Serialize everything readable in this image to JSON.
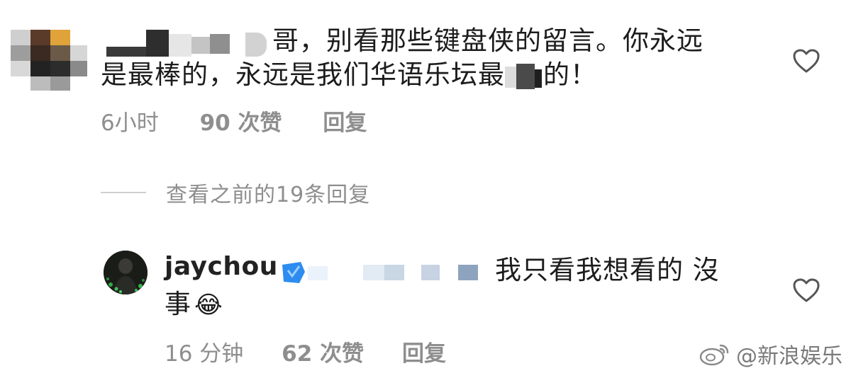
{
  "comment1": {
    "line1_text": "哥，别看那些键盘侠的留言。你永远",
    "line2_part1": "是最棒的，永远是我们华语乐坛最",
    "line2_part2": "的！",
    "time": "6小时",
    "likes": "90 次赞",
    "reply_label": "回复"
  },
  "view_more": {
    "label": "查看之前的19条回复"
  },
  "reply": {
    "username": "jaychou",
    "text_line1": "我只看我想看的 沒",
    "text_line2": "事",
    "emoji": "😂",
    "time": "16 分钟",
    "likes": "62 次赞",
    "reply_label": "回复"
  },
  "watermark": {
    "text": "@新浪娱乐"
  },
  "icons": {
    "heart": "heart-outline-icon",
    "weibo": "weibo-logo-icon"
  },
  "colors": {
    "meta_gray": "#8e8e8e",
    "text": "#1c1c1c",
    "verified_blue": "#2d8cf0"
  }
}
